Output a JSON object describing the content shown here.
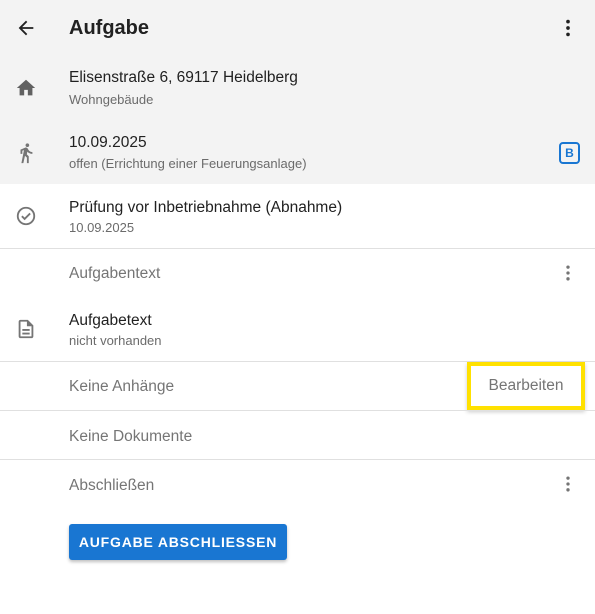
{
  "header": {
    "title": "Aufgabe",
    "back_icon": "arrow-left-icon",
    "menu_icon": "more-vert-icon"
  },
  "address": {
    "icon": "home-icon",
    "primary": "Elisenstraße 6, 69117 Heidelberg",
    "secondary": "Wohngebäude"
  },
  "visit": {
    "icon": "walk-icon",
    "primary": "10.09.2025",
    "secondary": "offen (Errichtung einer Feuerungsanlage)",
    "badge": "B",
    "badge_color": "#1976d2"
  },
  "task": {
    "icon": "check-circle-icon",
    "primary": "Prüfung vor Inbetriebnahme (Abnahme)",
    "secondary": "10.09.2025"
  },
  "task_text_section": {
    "label": "Aufgabentext"
  },
  "task_text": {
    "icon": "document-icon",
    "primary": "Aufgabetext",
    "secondary": "nicht vorhanden"
  },
  "attachments": {
    "label": "Keine Anhänge",
    "edit_label": "Bearbeiten",
    "highlight_color": "#ffe100"
  },
  "documents": {
    "label": "Keine Dokumente"
  },
  "complete_section": {
    "label": "Abschließen",
    "button_label": "AUFGABE ABSCHLIESSEN",
    "accent": "#1976d2"
  }
}
